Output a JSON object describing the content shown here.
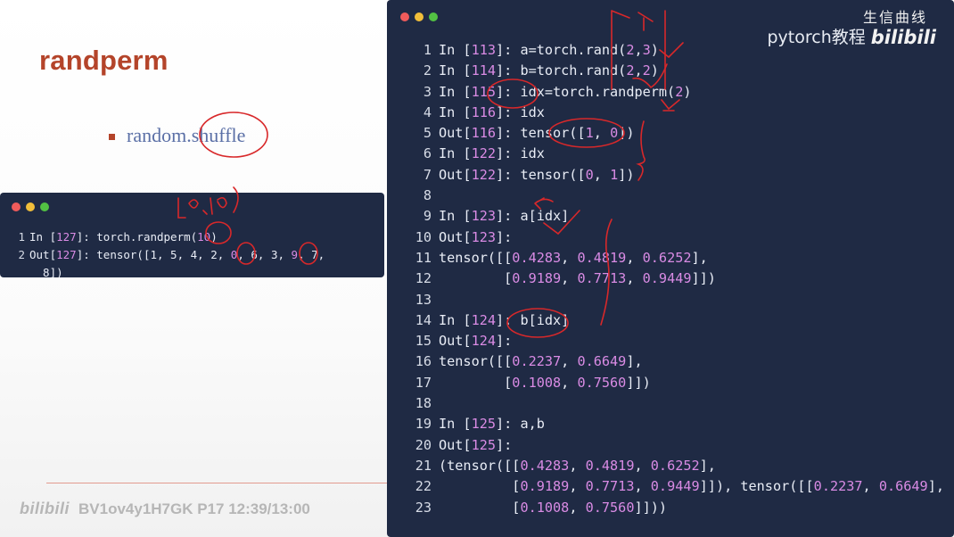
{
  "slide": {
    "title": "randperm",
    "bullet_text": "random.shuffle"
  },
  "watermark": {
    "logo": "bilibili",
    "text": "BV1ov4y1H7GK P17 12:39/13:00"
  },
  "small_terminal": {
    "lines": [
      {
        "n": "1",
        "segs": [
          {
            "t": "In ["
          },
          {
            "t": "127",
            "c": "num"
          },
          {
            "t": "]: torch.randperm("
          },
          {
            "t": "10",
            "c": "num"
          },
          {
            "t": ")"
          }
        ]
      },
      {
        "n": "2",
        "segs": [
          {
            "t": "Out["
          },
          {
            "t": "127",
            "c": "num"
          },
          {
            "t": "]: tensor([1, 5, 4, 2, "
          },
          {
            "t": "0",
            "c": "num"
          },
          {
            "t": ", 6, 3, "
          },
          {
            "t": "9",
            "c": "num"
          },
          {
            "t": ", 7,"
          }
        ]
      },
      {
        "n": "",
        "segs": [
          {
            "t": "  8])"
          }
        ]
      }
    ]
  },
  "big_terminal": {
    "brand_text": "pytorch教程",
    "brand_logo": "bilibili",
    "brand_handwriting": "生信曲线",
    "lines": [
      {
        "n": "1",
        "segs": [
          {
            "t": "In ["
          },
          {
            "t": "113",
            "c": "num"
          },
          {
            "t": "]: a=torch.rand("
          },
          {
            "t": "2",
            "c": "num"
          },
          {
            "t": ","
          },
          {
            "t": "3",
            "c": "num"
          },
          {
            "t": ")"
          }
        ]
      },
      {
        "n": "2",
        "segs": [
          {
            "t": "In ["
          },
          {
            "t": "114",
            "c": "num"
          },
          {
            "t": "]: b=torch.rand("
          },
          {
            "t": "2",
            "c": "num"
          },
          {
            "t": ","
          },
          {
            "t": "2",
            "c": "num"
          },
          {
            "t": ")"
          }
        ]
      },
      {
        "n": "3",
        "segs": [
          {
            "t": "In ["
          },
          {
            "t": "115",
            "c": "num"
          },
          {
            "t": "]: idx=torch.randperm("
          },
          {
            "t": "2",
            "c": "num"
          },
          {
            "t": ")"
          }
        ]
      },
      {
        "n": "4",
        "segs": [
          {
            "t": "In ["
          },
          {
            "t": "116",
            "c": "num"
          },
          {
            "t": "]: idx"
          }
        ]
      },
      {
        "n": "5",
        "segs": [
          {
            "t": "Out["
          },
          {
            "t": "116",
            "c": "num"
          },
          {
            "t": "]: tensor(["
          },
          {
            "t": "1",
            "c": "num"
          },
          {
            "t": ", "
          },
          {
            "t": "0",
            "c": "num"
          },
          {
            "t": "])"
          }
        ]
      },
      {
        "n": "6",
        "segs": [
          {
            "t": "In ["
          },
          {
            "t": "122",
            "c": "num"
          },
          {
            "t": "]: idx"
          }
        ]
      },
      {
        "n": "7",
        "segs": [
          {
            "t": "Out["
          },
          {
            "t": "122",
            "c": "num"
          },
          {
            "t": "]: tensor(["
          },
          {
            "t": "0",
            "c": "num"
          },
          {
            "t": ", "
          },
          {
            "t": "1",
            "c": "num"
          },
          {
            "t": "])"
          }
        ]
      },
      {
        "n": "8",
        "segs": [
          {
            "t": ""
          }
        ]
      },
      {
        "n": "9",
        "segs": [
          {
            "t": "In ["
          },
          {
            "t": "123",
            "c": "num"
          },
          {
            "t": "]: a[idx]"
          }
        ]
      },
      {
        "n": "10",
        "segs": [
          {
            "t": "Out["
          },
          {
            "t": "123",
            "c": "num"
          },
          {
            "t": "]:"
          }
        ]
      },
      {
        "n": "11",
        "segs": [
          {
            "t": "tensor([["
          },
          {
            "t": "0.4283",
            "c": "num"
          },
          {
            "t": ", "
          },
          {
            "t": "0.4819",
            "c": "num"
          },
          {
            "t": ", "
          },
          {
            "t": "0.6252",
            "c": "num"
          },
          {
            "t": "],"
          }
        ]
      },
      {
        "n": "12",
        "segs": [
          {
            "t": "        ["
          },
          {
            "t": "0.9189",
            "c": "num"
          },
          {
            "t": ", "
          },
          {
            "t": "0.7713",
            "c": "num"
          },
          {
            "t": ", "
          },
          {
            "t": "0.9449",
            "c": "num"
          },
          {
            "t": "]])"
          }
        ]
      },
      {
        "n": "13",
        "segs": [
          {
            "t": ""
          }
        ]
      },
      {
        "n": "14",
        "segs": [
          {
            "t": "In ["
          },
          {
            "t": "124",
            "c": "num"
          },
          {
            "t": "]: b[idx]"
          }
        ]
      },
      {
        "n": "15",
        "segs": [
          {
            "t": "Out["
          },
          {
            "t": "124",
            "c": "num"
          },
          {
            "t": "]:"
          }
        ]
      },
      {
        "n": "16",
        "segs": [
          {
            "t": "tensor([["
          },
          {
            "t": "0.2237",
            "c": "num"
          },
          {
            "t": ", "
          },
          {
            "t": "0.6649",
            "c": "num"
          },
          {
            "t": "],"
          }
        ]
      },
      {
        "n": "17",
        "segs": [
          {
            "t": "        ["
          },
          {
            "t": "0.1008",
            "c": "num"
          },
          {
            "t": ", "
          },
          {
            "t": "0.7560",
            "c": "num"
          },
          {
            "t": "]])"
          }
        ]
      },
      {
        "n": "18",
        "segs": [
          {
            "t": ""
          }
        ]
      },
      {
        "n": "19",
        "segs": [
          {
            "t": "In ["
          },
          {
            "t": "125",
            "c": "num"
          },
          {
            "t": "]: a,b"
          }
        ]
      },
      {
        "n": "20",
        "segs": [
          {
            "t": "Out["
          },
          {
            "t": "125",
            "c": "num"
          },
          {
            "t": "]:"
          }
        ]
      },
      {
        "n": "21",
        "segs": [
          {
            "t": "(tensor([["
          },
          {
            "t": "0.4283",
            "c": "num"
          },
          {
            "t": ", "
          },
          {
            "t": "0.4819",
            "c": "num"
          },
          {
            "t": ", "
          },
          {
            "t": "0.6252",
            "c": "num"
          },
          {
            "t": "],"
          }
        ]
      },
      {
        "n": "22",
        "segs": [
          {
            "t": "         ["
          },
          {
            "t": "0.9189",
            "c": "num"
          },
          {
            "t": ", "
          },
          {
            "t": "0.7713",
            "c": "num"
          },
          {
            "t": ", "
          },
          {
            "t": "0.9449",
            "c": "num"
          },
          {
            "t": "]]), tensor([["
          },
          {
            "t": "0.2237",
            "c": "num"
          },
          {
            "t": ", "
          },
          {
            "t": "0.6649",
            "c": "num"
          },
          {
            "t": "],"
          }
        ]
      },
      {
        "n": "23",
        "segs": [
          {
            "t": "         ["
          },
          {
            "t": "0.1008",
            "c": "num"
          },
          {
            "t": ", "
          },
          {
            "t": "0.7560",
            "c": "num"
          },
          {
            "t": "]]))"
          }
        ]
      }
    ]
  },
  "colors": {
    "title": "#b4442a",
    "terminal_bg": "#1f2a44",
    "number_magenta": "#d98be4",
    "annotation_red": "#d8282a"
  },
  "icons": [
    "close-dot",
    "minimize-dot",
    "maximize-dot"
  ]
}
